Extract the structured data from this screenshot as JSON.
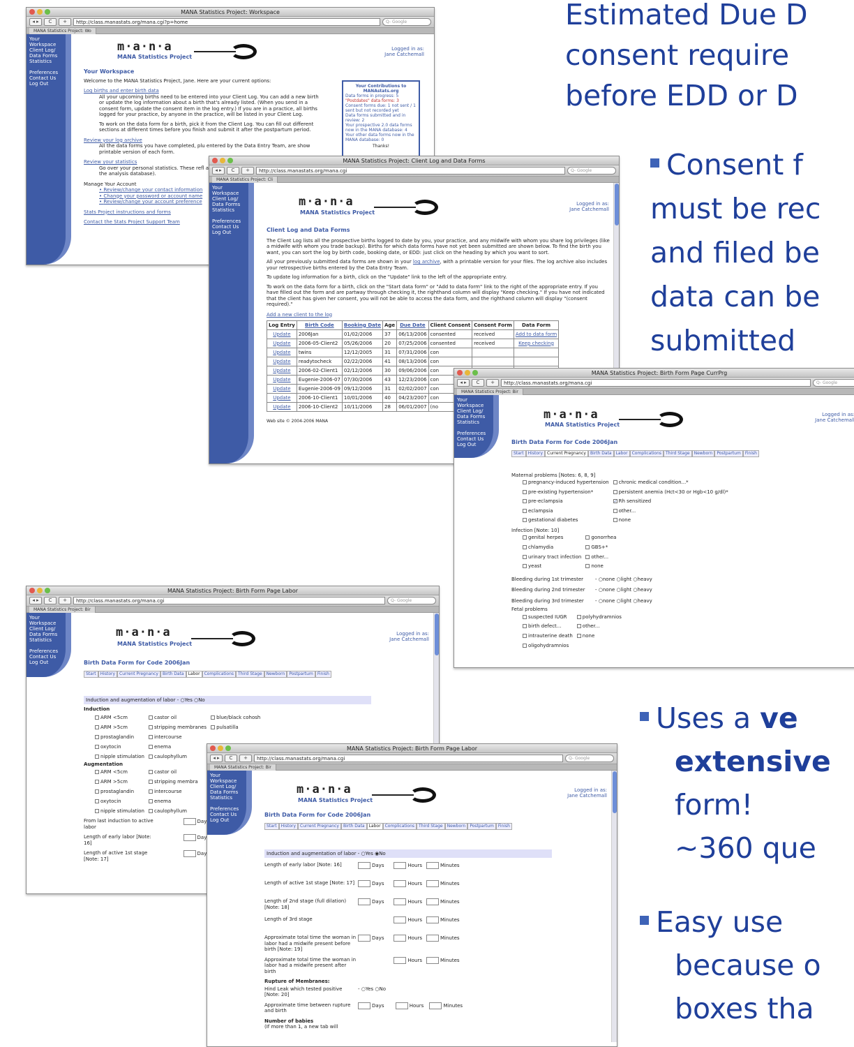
{
  "bullets": {
    "b1_l1": "Estimated Due D",
    "b1_l2": "consent require",
    "b1_l3": "before EDD or D",
    "b2_l1": "Consent f",
    "b2_l2": "must be rec",
    "b2_l3": "and filed be",
    "b2_l4": "data can be",
    "b2_l5": "submitted",
    "b3_l1a": "Uses a ",
    "b3_l1b": "ve",
    "b3_l2": "extensive",
    "b3_l3": "form!",
    "b3_l4": "~360 que",
    "b4_l1": "Easy use",
    "b4_l2": "because o",
    "b4_l3": "boxes tha"
  },
  "common": {
    "logo": "m·a·n·a",
    "logo_sub": "MANA Statistics Project",
    "logged_l1": "Logged in as:",
    "logged_l2": "Jane Catchemall",
    "search_placeholder": "Q- Google",
    "nav": {
      "workspace": "Your Workspace",
      "clientlog": "Client Log/",
      "dataforms": "Data Forms",
      "statistics": "Statistics",
      "preferences": "Preferences",
      "contact": "Contact Us",
      "logout": "Log Out"
    }
  },
  "w1": {
    "title": "MANA Statistics Project: Workspace",
    "url": "http://class.manastats.org/mana.cgi?p=home",
    "tab": "MANA Statistics Project: Wo",
    "heading": "Your Workspace",
    "welcome": "Welcome to the MANA Statistics Project, Jane. Here are your current options:",
    "link1": "Log births and enter birth data",
    "p1": "All your upcoming births need to be entered into your Client Log. You can add a new birth or update the log information about a birth that's already listed. (When you send in a consent form, update the consent item in the log entry.) If you are in a practice, all births logged for your practice, by anyone in the practice, will be listed in your Client Log.",
    "p2": "To work on the data form for a birth, pick it from the Client Log. You can fill out different sections at different times before you finish and submit it after the postpartum period.",
    "link2": "Review your log archive",
    "p3": "All the data forms you have completed, plu entered by the Data Entry Team, are show printable version of each form.",
    "link3": "Review your statistics",
    "p4": "Go over your personal statistics. These refl analysis so far (it may take a week or two into the analysis database).",
    "manage": "Manage Your Account",
    "m1": "Review/change your contact information",
    "m2": "Change your password or account name",
    "m3": "Review/change your account preference",
    "link4": "Stats Project instructions and forms",
    "link5": "Contact the Stats Project Support Team",
    "contrib_title": "Your Contributions to MANAstats.org",
    "c1": "Data forms in progress: 5",
    "c2": "\"Postdates\" data forms: 3",
    "c3": "Consent forms due: 1 not sent / 1 sent but not recorded yet",
    "c4": "Data forms submitted and in review: 2",
    "c5": "Your prospective 2.0 data forms now in the MANA database: 4",
    "c6": "Your other data forms now in the MANA database: 0",
    "thanks": "Thanks!"
  },
  "w2": {
    "title": "MANA Statistics Project: Client Log and Data Forms",
    "url": "http://class.manastats.org/mana.cgi",
    "tab": "MANA Statistics Project: Cli",
    "heading": "Client Log and Data Forms",
    "p1": "The Client Log lists all the prospective births logged to date by you, your practice, and any midwife with whom you share log privileges (like a midwife with whom you trade backup). Births for which data forms have not yet been submitted are shown below. To find the birth you want, you can sort the log by birth code, booking date, or EDD: just click on the heading by which you want to sort.",
    "p2a": "All your previously submitted data forms are shown in your ",
    "p2link": "log archive",
    "p2b": ", with a printable version for your files. The log archive also includes your retrospective births entered by the Data Entry Team.",
    "p3": "To update log information for a birth, click on the \"Update\" link to the left of the appropriate entry.",
    "p4": "To work on the data form for a birth, click on the \"Start data form\" or \"Add to data form\" link to the right of the appropriate entry. If you have filled out the form and are partway through checking it, the righthand column will display \"Keep checking.\" If you have not indicated that the client has given her consent, you will not be able to access the data form, and the righthand column will display \"(consent required).\"",
    "addlink": "Add a new client to the log",
    "cols": [
      "Log Entry",
      "Birth Code",
      "Booking Date",
      "Age",
      "Due Date",
      "Client Consent",
      "Consent Form",
      "Data Form"
    ],
    "rows": [
      [
        "Update",
        "2006Jan",
        "01/02/2006",
        "37",
        "06/13/2006",
        "consented",
        "received",
        "Add to data form"
      ],
      [
        "Update",
        "2006-05-Client2",
        "05/26/2006",
        "20",
        "07/25/2006",
        "consented",
        "received",
        "Keep checking"
      ],
      [
        "Update",
        "twins",
        "12/12/2005",
        "31",
        "07/31/2006",
        "con",
        "",
        ""
      ],
      [
        "Update",
        "readytocheck",
        "02/22/2006",
        "41",
        "08/13/2006",
        "con",
        "",
        ""
      ],
      [
        "Update",
        "2006-02-Client1",
        "02/12/2006",
        "30",
        "09/06/2006",
        "con",
        "",
        ""
      ],
      [
        "Update",
        "Eugenie-2006-07",
        "07/30/2006",
        "43",
        "12/23/2006",
        "con",
        "",
        ""
      ],
      [
        "Update",
        "Eugenie-2006-09",
        "09/12/2006",
        "31",
        "02/02/2007",
        "con",
        "",
        ""
      ],
      [
        "Update",
        "2006-10-Client1",
        "10/01/2006",
        "40",
        "04/23/2007",
        "con",
        "",
        ""
      ],
      [
        "Update",
        "2006-10-Client2",
        "10/11/2006",
        "28",
        "06/01/2007",
        "(no",
        "",
        ""
      ]
    ],
    "footer": "Web site © 2004-2006 MANA"
  },
  "w3": {
    "title": "MANA Statistics Project: Birth Form Page CurrPrg",
    "url": "http://class.manastats.org/mana.cgi",
    "tab": "MANA Statistics Project: Bir",
    "heading": "Birth Data Form for Code 2006Jan",
    "tabs": [
      "Start",
      "History",
      "Current Pregnancy",
      "Birth Data",
      "Labor",
      "Complications",
      "Third Stage",
      "Newborn",
      "Postpartum",
      "Finish"
    ],
    "mat": "Maternal problems [Notes: 6, 8, 9]",
    "mat_l": [
      "pregnancy-induced hypertension",
      "pre-existing hypertension*",
      "pre-eclampsia",
      "eclampsia",
      "gestational diabetes"
    ],
    "mat_r": [
      "chronic medical condition...*",
      "persistent anemia (Hct<30 or Hgb<10 g/dl)*",
      "Rh sensitized",
      "other...",
      "none"
    ],
    "inf": "Infection [Note: 10]",
    "inf_l": [
      "genital herpes",
      "chlamydia",
      "urinary tract infection",
      "yeast"
    ],
    "inf_r": [
      "gonorrhea",
      "GBS+*",
      "other...",
      "none"
    ],
    "bleed": [
      "Bleeding during 1st trimester",
      "Bleeding during 2nd trimester",
      "Bleeding during 3rd trimester"
    ],
    "radio3": "- ○none ○light ○heavy",
    "fetal": "Fetal problems",
    "fet_l": [
      "suspected IUGR",
      "birth defect...",
      "intrauterine death",
      "oligohydramnios"
    ],
    "fet_r": [
      "polyhydramnios",
      "other...",
      "none"
    ]
  },
  "w4": {
    "title": "MANA Statistics Project: Birth Form Page Labor",
    "url": "http://class.manastats.org/mana.cgi",
    "tab": "MANA Statistics Project: Bir",
    "heading": "Birth Data Form for Code 2006Jan",
    "induct_q": "Induction and augmentation of labor",
    "yesno": "- ○Yes ○No",
    "induction": "Induction",
    "ind_c1": [
      "ARM <5cm",
      "ARM >5cm",
      "prostaglandin",
      "oxytocin",
      "nipple stimulation"
    ],
    "ind_c2": [
      "castor oil",
      "stripping membranes",
      "intercourse",
      "enema",
      "caulophyllum"
    ],
    "ind_c3": [
      "blue/black cohosh",
      "pulsatilla"
    ],
    "augmentation": "Augmentation",
    "aug_c1": [
      "ARM <5cm",
      "ARM >5cm",
      "prostaglandin",
      "oxytocin",
      "nipple stimulation"
    ],
    "aug_c2": [
      "castor oil",
      "stripping membra",
      "intercourse",
      "enema",
      "caulophyllum"
    ],
    "from_last": "From last induction to active labor",
    "early": "Length of early labor [Note: 16]",
    "active": "Length of active 1st stage [Note: 17]",
    "days": "Days"
  },
  "w5": {
    "title": "MANA Statistics Project: Birth Form Page Labor",
    "url": "http://class.manastats.org/mana.cgi",
    "tab": "MANA Statistics Project: Bir",
    "heading": "Birth Data Form for Code 2006Jan",
    "induct_q": "Induction and augmentation of labor",
    "yesno": "- ○Yes ◉No",
    "rows": [
      {
        "label": "Length of early labor [Note: 16]",
        "days": true
      },
      {
        "label": "Length of active 1st stage [Note: 17]",
        "days": true
      },
      {
        "label": "Length of 2nd stage (full dilation) [Note: 18]",
        "days": true
      },
      {
        "label": "Length of 3rd stage",
        "days": false
      },
      {
        "label": "Approximate total time the woman in labor had a midwife present before birth [Note: 19]",
        "days": true
      },
      {
        "label": "Approximate total time the woman in labor had a midwife present after birth",
        "days": false
      }
    ],
    "rupture": "Rupture of Membranes:",
    "hindleak": "Hind Leak which tested positive [Note: 20]",
    "hind_radio": "- ○Yes ○No",
    "approx_rupture": "Approximate time between rupture and birth",
    "babies": "Number of babies",
    "babies_note": "(If more than 1, a new tab will",
    "days": "Days",
    "hours": "Hours",
    "minutes": "Minutes"
  }
}
